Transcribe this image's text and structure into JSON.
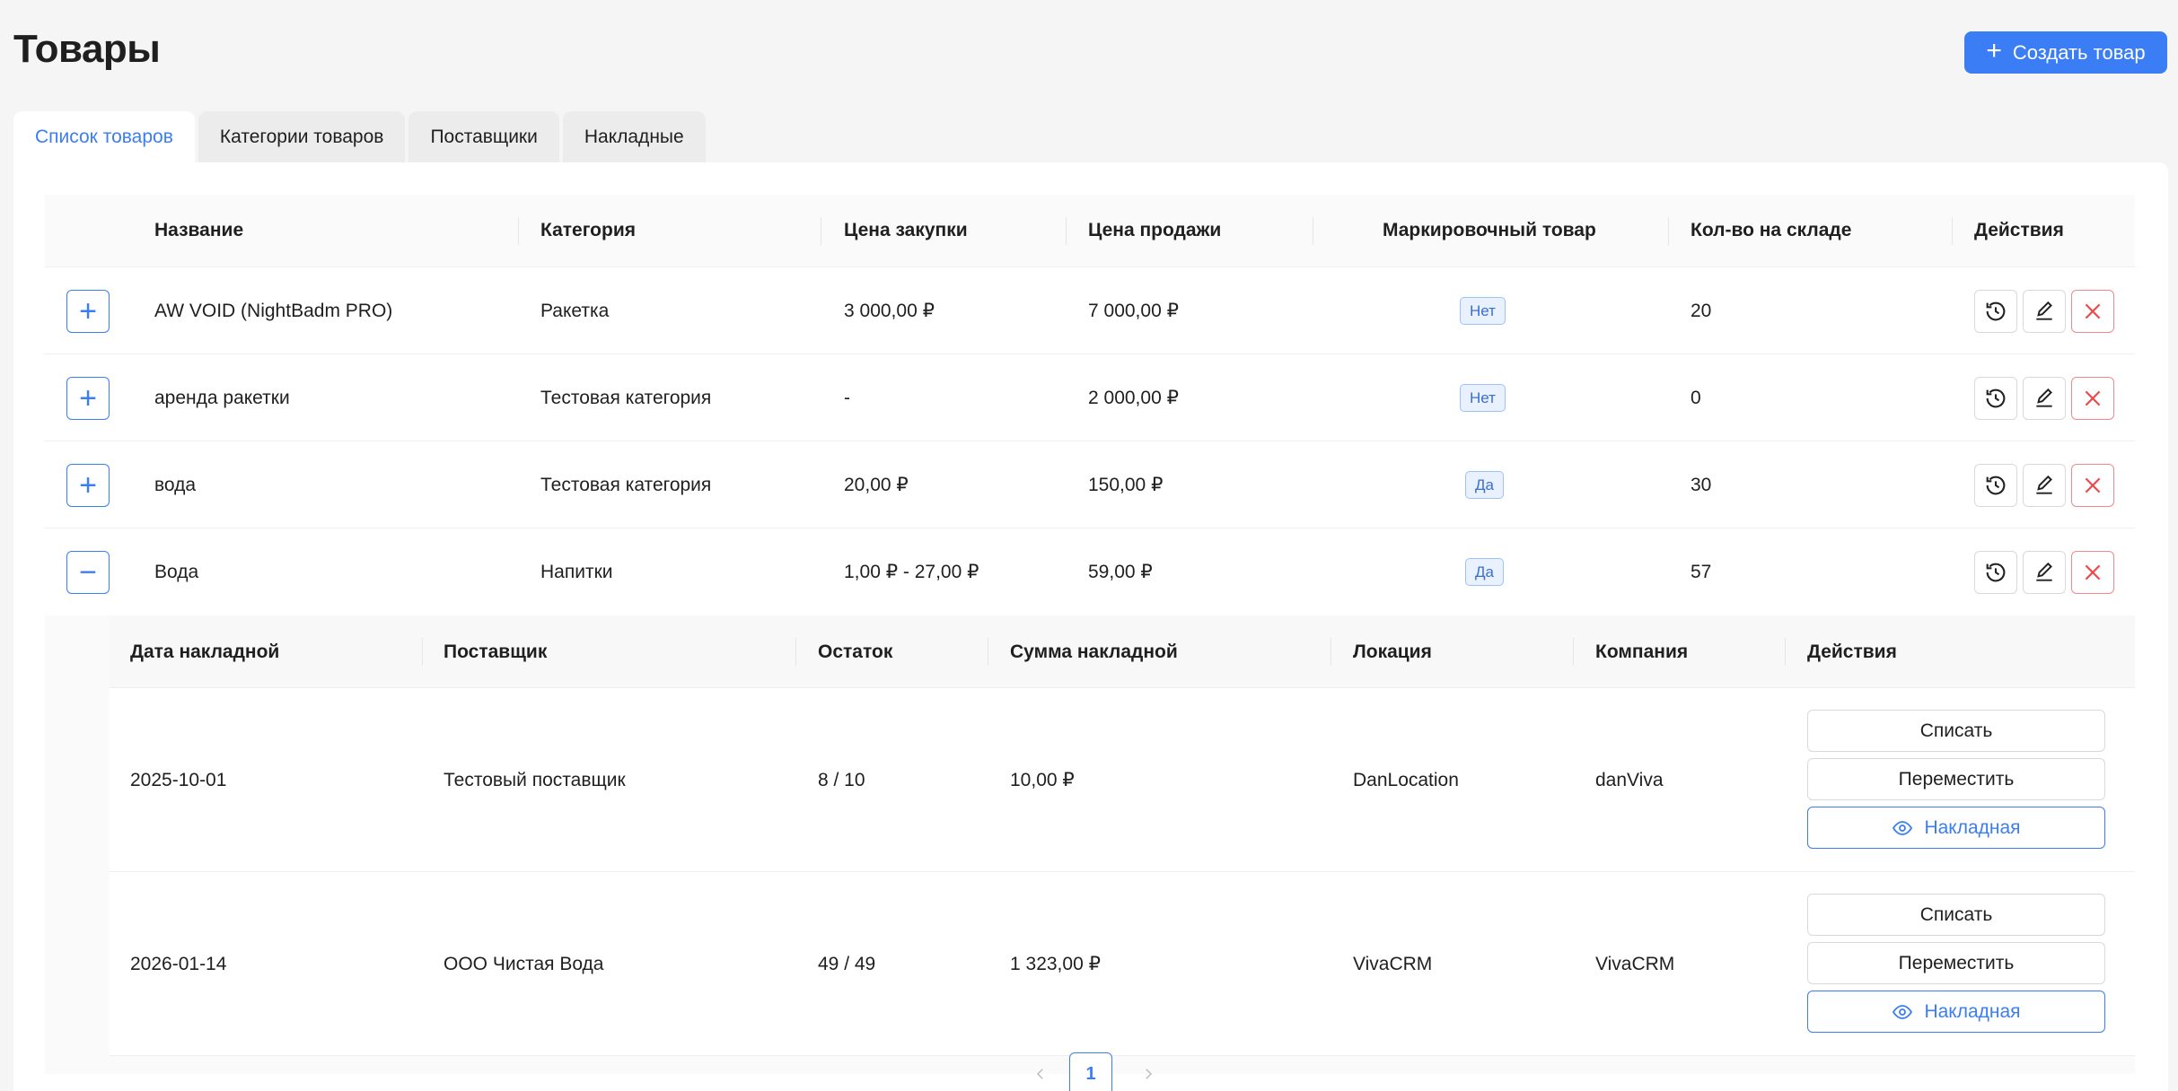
{
  "page": {
    "title": "Товары",
    "create_button": "Создать товар"
  },
  "tabs": [
    {
      "label": "Список товаров",
      "active": true
    },
    {
      "label": "Категории товаров",
      "active": false
    },
    {
      "label": "Поставщики",
      "active": false
    },
    {
      "label": "Накладные",
      "active": false
    }
  ],
  "table": {
    "headers": {
      "name": "Название",
      "category": "Категория",
      "buy_price": "Цена закупки",
      "sell_price": "Цена продажи",
      "marked": "Маркировочный товар",
      "stock": "Кол-во на складе",
      "actions": "Действия"
    },
    "rows": [
      {
        "name": "AW VOID (NightBadm PRO)",
        "category": "Ракетка",
        "buy_price": "3 000,00 ₽",
        "sell_price": "7 000,00 ₽",
        "marked": "Нет",
        "stock": "20",
        "expanded": false
      },
      {
        "name": "аренда ракетки",
        "category": "Тестовая категория",
        "buy_price": "-",
        "sell_price": "2 000,00 ₽",
        "marked": "Нет",
        "stock": "0",
        "expanded": false
      },
      {
        "name": "вода",
        "category": "Тестовая категория",
        "buy_price": "20,00 ₽",
        "sell_price": "150,00 ₽",
        "marked": "Да",
        "stock": "30",
        "expanded": false
      },
      {
        "name": "Вода",
        "category": "Напитки",
        "buy_price": "1,00 ₽ - 27,00 ₽",
        "sell_price": "59,00 ₽",
        "marked": "Да",
        "stock": "57",
        "expanded": true
      }
    ]
  },
  "subtable": {
    "headers": {
      "date": "Дата накладной",
      "supplier": "Поставщик",
      "remainder": "Остаток",
      "sum": "Сумма накладной",
      "location": "Локация",
      "company": "Компания",
      "actions": "Действия"
    },
    "rows": [
      {
        "date": "2025-10-01",
        "supplier": "Тестовый поставщик",
        "remainder": "8 / 10",
        "sum": "10,00 ₽",
        "location": "DanLocation",
        "company": "danViva"
      },
      {
        "date": "2026-01-14",
        "supplier": "ООО Чистая Вода",
        "remainder": "49 / 49",
        "sum": "1 323,00 ₽",
        "location": "VivaCRM",
        "company": "VivaCRM"
      }
    ],
    "buttons": {
      "write_off": "Списать",
      "move": "Переместить",
      "invoice": "Накладная"
    }
  },
  "pagination": {
    "current_page": "1"
  },
  "colors": {
    "accent": "#3b7df4",
    "danger": "#f0474a",
    "badge_bg": "#e8f1fd"
  }
}
